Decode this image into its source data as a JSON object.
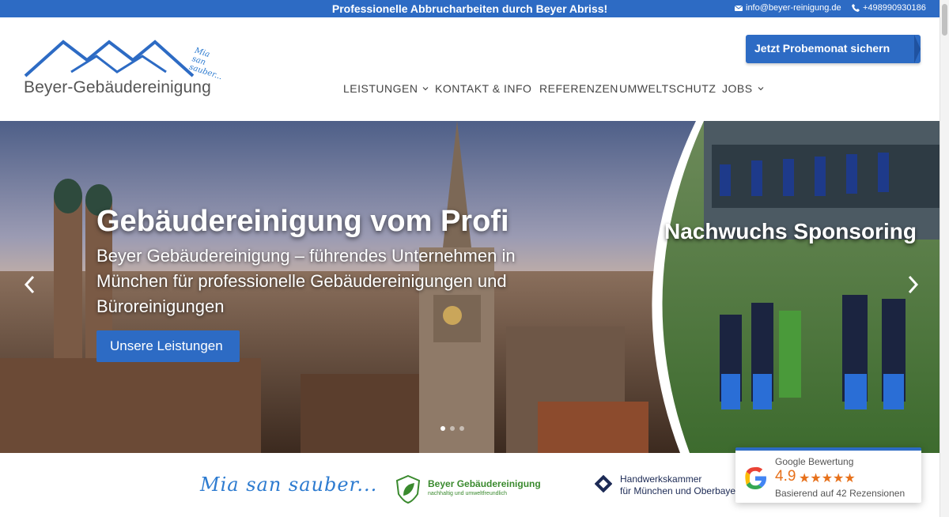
{
  "topbar": {
    "announcement": "Professionelle Abbrucharbeiten durch Beyer Abriss!",
    "email": "info@beyer-reinigung.de",
    "phone": "+498990930186"
  },
  "header": {
    "logo_text": "Beyer-Gebäudereinigung",
    "logo_slogan": "Mia san sauber...",
    "cta_label": "Jetzt Probemonat sichern",
    "nav": [
      {
        "label": "LEISTUNGEN",
        "has_dropdown": true
      },
      {
        "label": "KONTAKT & INFO",
        "has_dropdown": false
      },
      {
        "label": "REFERENZEN",
        "has_dropdown": false
      },
      {
        "label": "UMWELTSCHUTZ",
        "has_dropdown": false
      },
      {
        "label": "JOBS",
        "has_dropdown": true
      }
    ]
  },
  "hero": {
    "title": "Gebäudereinigung vom Profi",
    "subtitle": "Beyer Gebäudereinigung – führendes Unternehmen in München für professionelle Gebäudereinigungen und Büroreinigungen",
    "button_label": "Unsere Leistungen",
    "sponsor_title": "Nachwuchs Sponsoring",
    "slide_count": 3,
    "active_slide": 1
  },
  "footer_band": {
    "slogan": "Mia san sauber...",
    "eco_name": "Beyer Gebäudereinigung",
    "eco_tagline": "nachhaltig und umweltfreundlich",
    "hwk_line1": "Handwerkskammer",
    "hwk_line2": "für München und Oberbayern"
  },
  "review": {
    "title": "Google Bewertung",
    "score": "4.9",
    "stars": "★★★★★",
    "count_text": "Basierend auf 42 Rezensionen"
  },
  "colors": {
    "brand_blue": "#2d6bc4",
    "eco_green": "#3a8a2e",
    "star_orange": "#e7711b"
  }
}
